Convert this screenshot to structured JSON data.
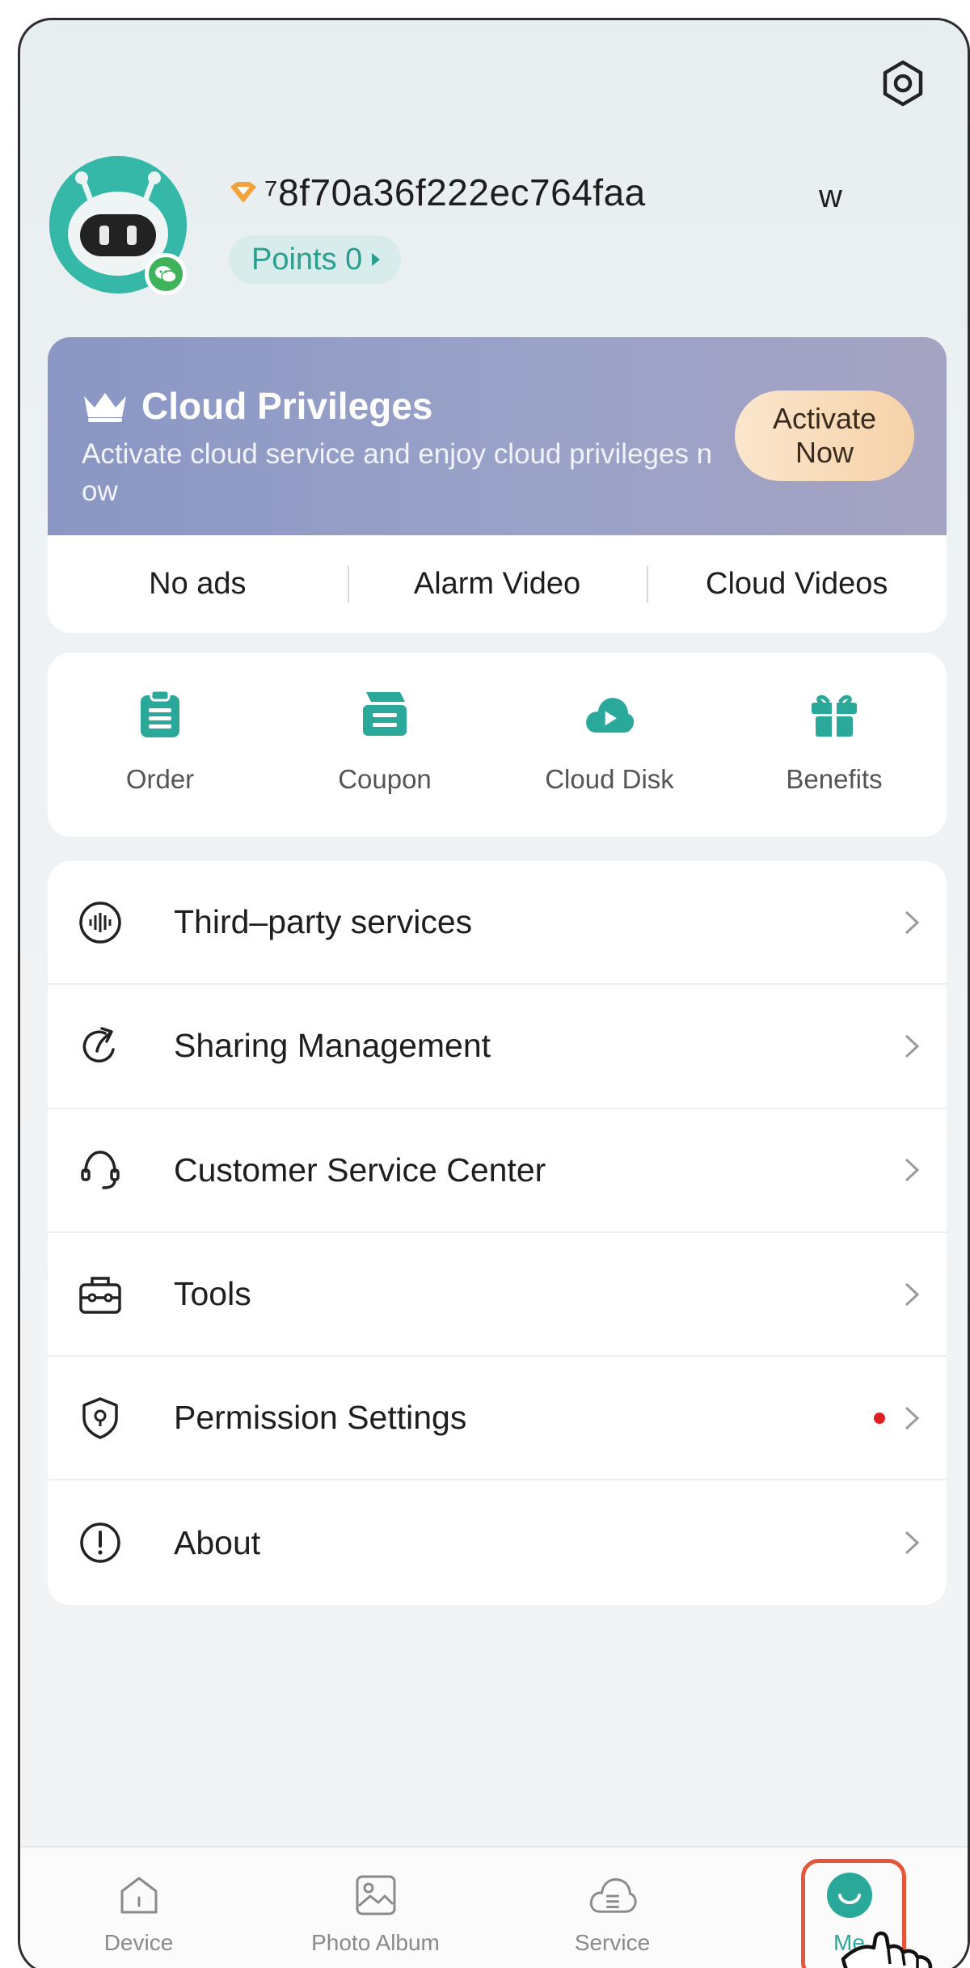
{
  "header": {
    "username": "⁷8f70a36f222ec764faa",
    "username_suffix": "w",
    "points_label": "Points 0"
  },
  "cloud": {
    "title": "Cloud Privileges",
    "description": "Activate cloud service and enjoy cloud privileges now",
    "activate_label_line1": "Activate",
    "activate_label_line2": "Now",
    "features": [
      "No ads",
      "Alarm Video",
      "Cloud Videos"
    ]
  },
  "quick_actions": [
    {
      "label": "Order",
      "icon": "clipboard-icon"
    },
    {
      "label": "Coupon",
      "icon": "coupon-icon"
    },
    {
      "label": "Cloud Disk",
      "icon": "cloud-play-icon"
    },
    {
      "label": "Benefits",
      "icon": "gift-icon"
    }
  ],
  "menu": [
    {
      "label": "Third–party services",
      "icon": "waveform-icon"
    },
    {
      "label": "Sharing Management",
      "icon": "share-arrow-icon"
    },
    {
      "label": "Customer Service Center",
      "icon": "headset-icon"
    },
    {
      "label": "Tools",
      "icon": "toolbox-icon"
    },
    {
      "label": "Permission Settings",
      "icon": "shield-icon",
      "has_dot": true
    },
    {
      "label": "About",
      "icon": "info-exclamation-icon"
    }
  ],
  "tabs": [
    {
      "label": "Device",
      "icon": "house-icon"
    },
    {
      "label": "Photo Album",
      "icon": "image-icon"
    },
    {
      "label": "Service",
      "icon": "cloud-list-icon"
    },
    {
      "label": "Me",
      "icon": "smile-icon",
      "active": true
    }
  ],
  "colors": {
    "accent": "#2aa899",
    "banner": "#8a97c4",
    "highlight": "#e5553a",
    "alert_dot": "#e02020"
  }
}
